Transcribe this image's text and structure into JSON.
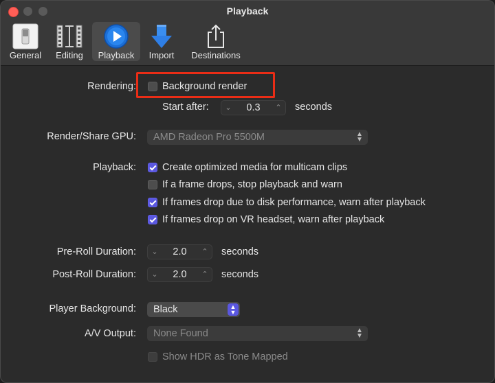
{
  "window": {
    "title": "Playback"
  },
  "toolbar": {
    "items": [
      {
        "label": "General",
        "icon": "general-switch-icon"
      },
      {
        "label": "Editing",
        "icon": "film-strip-icon"
      },
      {
        "label": "Playback",
        "icon": "play-circle-icon",
        "selected": true
      },
      {
        "label": "Import",
        "icon": "download-arrow-icon"
      },
      {
        "label": "Destinations",
        "icon": "share-icon"
      }
    ]
  },
  "rendering": {
    "label": "Rendering:",
    "background_render": {
      "label": "Background render",
      "checked": false
    },
    "start_after_label": "Start after:",
    "start_after_value": "0.3",
    "start_after_unit": "seconds"
  },
  "gpu": {
    "label": "Render/Share GPU:",
    "value": "AMD Radeon Pro 5500M"
  },
  "playback": {
    "label": "Playback:",
    "options": [
      {
        "label": "Create optimized media for multicam clips",
        "checked": true
      },
      {
        "label": "If a frame drops, stop playback and warn",
        "checked": false
      },
      {
        "label": "If frames drop due to disk performance, warn after playback",
        "checked": true
      },
      {
        "label": "If frames drop on VR headset, warn after playback",
        "checked": true
      }
    ]
  },
  "preroll": {
    "label": "Pre-Roll Duration:",
    "value": "2.0",
    "unit": "seconds"
  },
  "postroll": {
    "label": "Post-Roll Duration:",
    "value": "2.0",
    "unit": "seconds"
  },
  "player_background": {
    "label": "Player Background:",
    "value": "Black"
  },
  "av_output": {
    "label": "A/V Output:",
    "value": "None Found"
  },
  "hdr": {
    "label": "Show HDR as Tone Mapped",
    "checked": false,
    "enabled": false
  },
  "colors": {
    "accent": "#5a57e0",
    "highlight_box": "#ea2d16",
    "close_button": "#ff5f57"
  }
}
